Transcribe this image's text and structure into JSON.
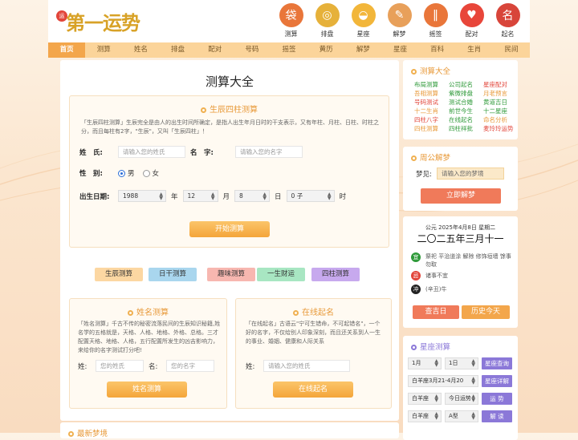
{
  "logo": {
    "seal": "运",
    "text": "第一运势"
  },
  "top_icons": [
    {
      "label": "测算",
      "icon": "money-bag-icon",
      "glyph": "袋",
      "color": "#e9763a"
    },
    {
      "label": "排盘",
      "icon": "coin-icon",
      "glyph": "◎",
      "color": "#e6b13a"
    },
    {
      "label": "星座",
      "icon": "ufo-icon",
      "glyph": "◒",
      "color": "#f2b63a"
    },
    {
      "label": "解梦",
      "icon": "scroll-icon",
      "glyph": "✎",
      "color": "#e8a05a"
    },
    {
      "label": "摇签",
      "icon": "fortune-sticks-icon",
      "glyph": "‖",
      "color": "#e9763a"
    },
    {
      "label": "配对",
      "icon": "hearts-icon",
      "glyph": "♥",
      "color": "#e8463a"
    },
    {
      "label": "起名",
      "icon": "name-book-icon",
      "glyph": "名",
      "color": "#d8453a"
    }
  ],
  "nav": [
    "首页",
    "测算",
    "姓名",
    "排盘",
    "配对",
    "号码",
    "摇签",
    "黄历",
    "解梦",
    "星座",
    "百科",
    "生肖",
    "民间"
  ],
  "main": {
    "title": "测算大全",
    "bazi": {
      "title": "生辰四柱测算",
      "desc": "「生辰四柱测算」生辰完全是由人的出生时间所确定，是指人出生年月日时的干支表示，又有年柱、月柱、日柱、时柱之分，而且每柱有2字，\"生辰\"，又叫「生辰四柱」！",
      "name_label": "姓　氏:",
      "surname_placeholder": "请输入您的姓氏",
      "given_label": "名　字:",
      "given_placeholder": "请输入您的名字",
      "gender_label": "性　别:",
      "male": "男",
      "female": "女",
      "birth_label": "出生日期:",
      "year": "1988",
      "year_unit": "年",
      "month": "12",
      "month_unit": "月",
      "day": "8",
      "day_unit": "日",
      "hour": "0 子",
      "hour_unit": "时",
      "submit": "开始测算"
    },
    "categories": [
      {
        "label": "生辰测算",
        "color": "#fcd7a2"
      },
      {
        "label": "日干测算",
        "color": "#a9d6ee"
      },
      {
        "label": "趣味测算",
        "color": "#f7b7b0"
      },
      {
        "label": "一生财运",
        "color": "#a8e6c2"
      },
      {
        "label": "四柱测算",
        "color": "#c7a9ee"
      }
    ],
    "name_test": {
      "title": "姓名测算",
      "desc": "「姓名测算」千古不传的秘密流落民间的生辰知识秘籍,姓名学的五格就是，天格、人格、地格、外格、总格。三才配置天格、地格、人格，五行配置所发生的凶吉影响力，来给你的名字测试打分吧!",
      "surname_label": "姓:",
      "surname_placeholder": "您的姓氏",
      "given_label": "名:",
      "given_placeholder": "您的名字",
      "submit": "姓名测算"
    },
    "naming": {
      "title": "在线起名",
      "desc": "「在线起名」古语云\"宁可生错命，不可起错名\"，一个好的名字，不仅给别人印象深刻，而且还关系到人一生的事业、婚姻、健康和人际关系",
      "surname_label": "姓:",
      "surname_placeholder": "请输入您的姓氏",
      "submit": "在线起名"
    },
    "next_section": "最新梦境"
  },
  "side": {
    "calc": {
      "title": "测算大全",
      "links": [
        {
          "t": "布局测算",
          "c": "#2f9a3a"
        },
        {
          "t": "公司起名",
          "c": "#2f9a3a"
        },
        {
          "t": "星座配对",
          "c": "#e2453a"
        },
        {
          "t": "吾相测算",
          "c": "#e89a3a"
        },
        {
          "t": "紫微排盘",
          "c": "#2f9a3a"
        },
        {
          "t": "月老预言",
          "c": "#e89a3a"
        },
        {
          "t": "号码测试",
          "c": "#e2453a"
        },
        {
          "t": "测试合婚",
          "c": "#2f9a3a"
        },
        {
          "t": "黄道吉日",
          "c": "#2f9a3a"
        },
        {
          "t": "十二生肖",
          "c": "#e89a3a"
        },
        {
          "t": "前世今生",
          "c": "#2f9a3a"
        },
        {
          "t": "十二星座",
          "c": "#2f9a3a"
        },
        {
          "t": "四柱八字",
          "c": "#e2453a"
        },
        {
          "t": "在线起名",
          "c": "#2f9a3a"
        },
        {
          "t": "命名分析",
          "c": "#e89a3a"
        },
        {
          "t": "四柱测算",
          "c": "#e89a3a"
        },
        {
          "t": "四柱祥批",
          "c": "#2f9a3a"
        },
        {
          "t": "麦玲玲运势",
          "c": "#e2453a"
        }
      ]
    },
    "dream": {
      "title": "周公解梦",
      "label": "梦见:",
      "placeholder": "请输入您的梦境",
      "submit": "立即解梦"
    },
    "calendar": {
      "date": "公元 2025年4月8日 星期二",
      "lunar": "二〇二五年三月十一",
      "yi_badge": "宜",
      "yi": "祭祀 平治道涂 解除 修饰垣墙 馀事勿取",
      "ji_badge": "忌",
      "ji": "诸事不宜",
      "chong_badge": "冲",
      "chong": "(辛丑)牛",
      "btn1": "查吉日",
      "btn2": "历史今天"
    },
    "astro": {
      "title": "星座测算",
      "sel_month": "1月",
      "sel_day": "1日",
      "btn_query": "星座查询",
      "sel_sign": "白羊座3月21-4月20",
      "btn_detail": "星座详解",
      "sel_sign2": "白羊座",
      "sel_today": "今日运势",
      "btn_fortune": "运 势",
      "sel_sign3": "白羊座",
      "sel_blood": "A型",
      "btn_read": "解 读"
    }
  }
}
